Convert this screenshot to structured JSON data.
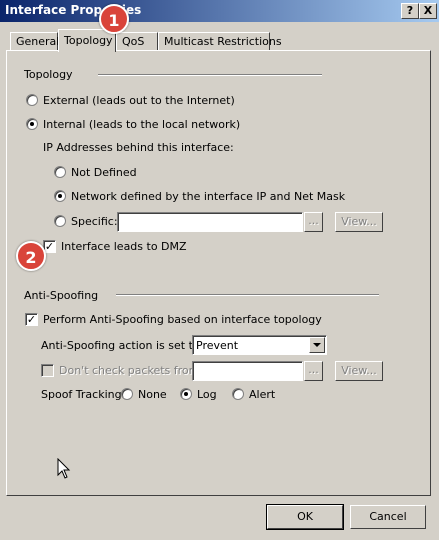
{
  "window": {
    "title": "Interface Properties"
  },
  "tabs": [
    "General",
    "Topology",
    "QoS",
    "Multicast Restrictions"
  ],
  "topology": {
    "section_label": "Topology",
    "external_label": "External (leads out to the Internet)",
    "internal_label": "Internal (leads to the local network)",
    "ip_behind_label": "IP Addresses behind this interface:",
    "not_defined_label": "Not Defined",
    "network_defined_label": "Network defined by the interface IP and Net Mask",
    "specific_label": "Specific:",
    "specific_value": "",
    "browse_label": "...",
    "view_label": "View...",
    "dmz_label": "Interface leads to DMZ"
  },
  "anti_spoofing": {
    "section_label": "Anti-Spoofing",
    "perform_label": "Perform Anti-Spoofing based on interface topology",
    "action_label": "Anti-Spoofing action is set to",
    "action_value": "Prevent",
    "dont_check_label": "Don't check packets from:",
    "dont_check_value": "",
    "browse_label": "...",
    "view_label": "View...",
    "tracking_label": "Spoof Tracking:",
    "tracking_options": [
      "None",
      "Log",
      "Alert"
    ]
  },
  "buttons": {
    "ok": "OK",
    "cancel": "Cancel"
  },
  "title_buttons": {
    "help": "?",
    "close": "X"
  },
  "badges": [
    "1",
    "2"
  ],
  "colors": {
    "badge": "#d9443a",
    "titlebar": "#0a246a"
  }
}
